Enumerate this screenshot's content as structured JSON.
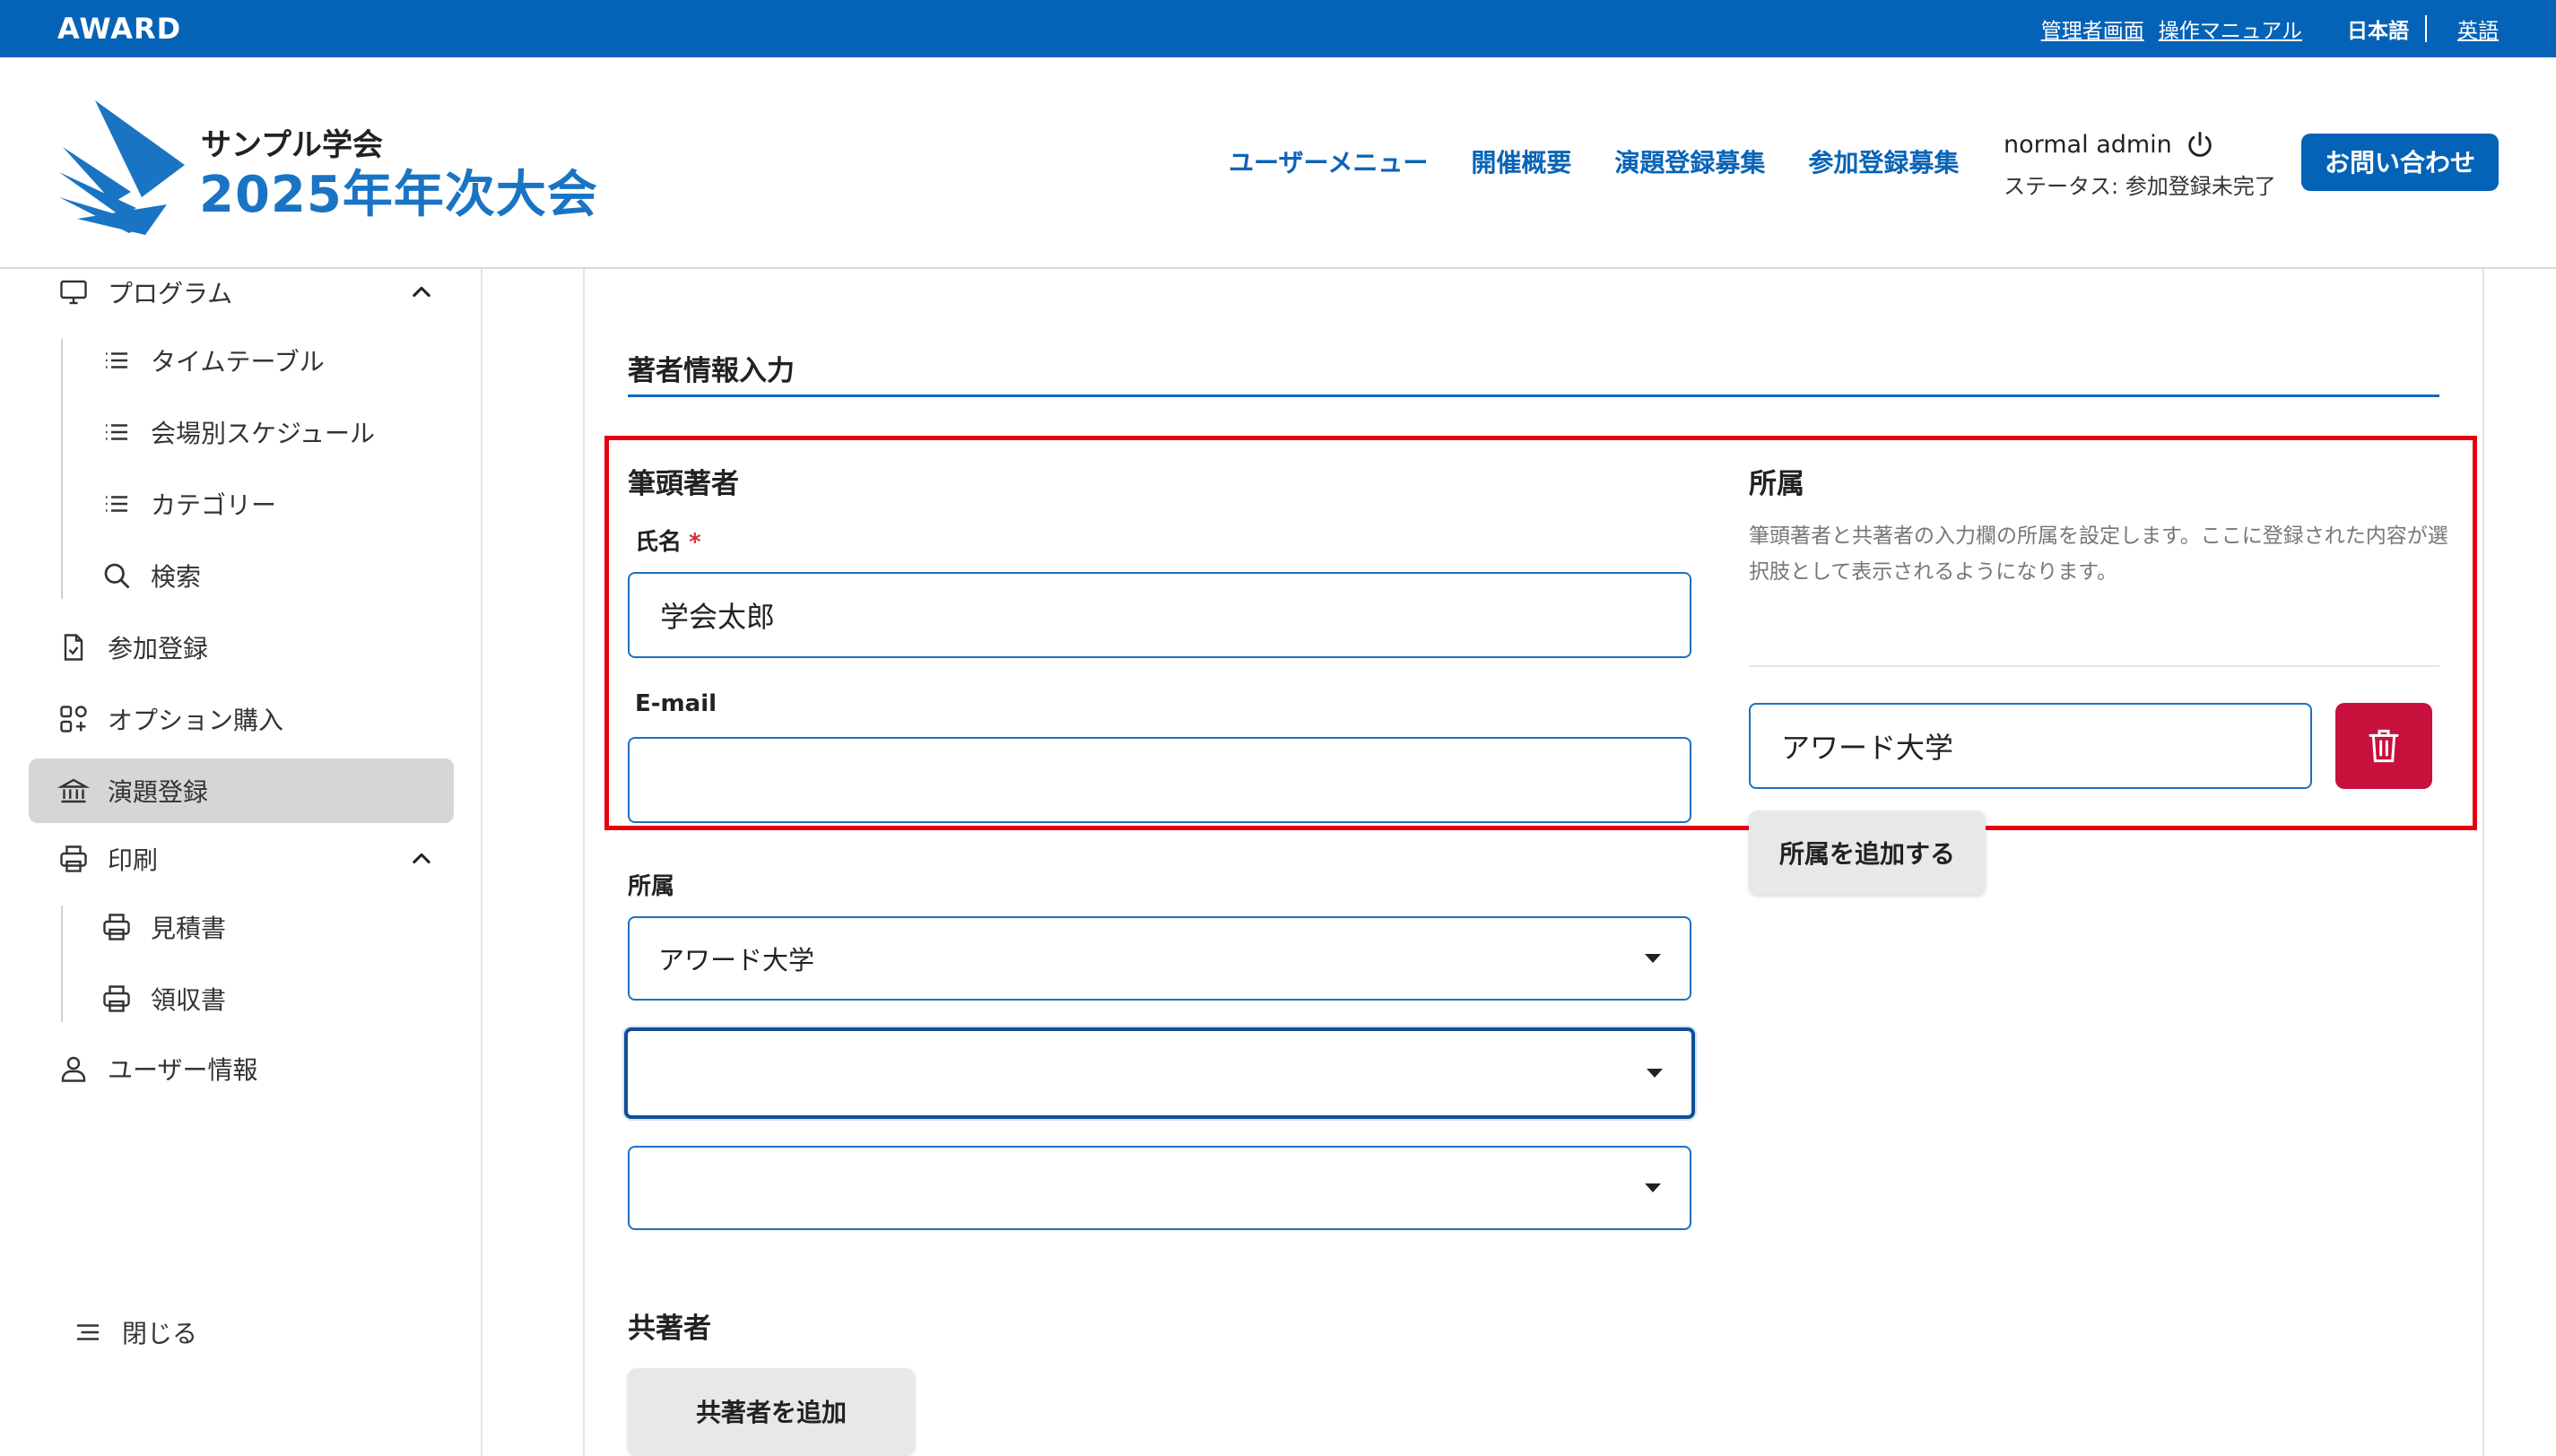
{
  "topbar": {
    "logo": "AWARD",
    "admin_link": "管理者画面",
    "manual_link": "操作マニュアル",
    "lang_current": "日本語",
    "lang_other": "英語"
  },
  "header": {
    "brand_sub": "サンプル学会",
    "brand_main": "2025年年次大会",
    "nav": [
      "ユーザーメニュー",
      "開催概要",
      "演題登録募集",
      "参加登録募集"
    ],
    "user_name": "normal admin",
    "user_status": "ステータス: 参加登録未完了",
    "contact_label": "お問い合わせ"
  },
  "sidebar": {
    "program": "プログラム",
    "timetable": "タイムテーブル",
    "venue_schedule": "会場別スケジュール",
    "category": "カテゴリー",
    "search": "検索",
    "participation": "参加登録",
    "option": "オプション購入",
    "abstract": "演題登録",
    "print": "印刷",
    "estimate": "見積書",
    "receipt": "領収書",
    "user_info": "ユーザー情報",
    "close": "閉じる"
  },
  "form": {
    "section_title": "著者情報入力",
    "first_author_heading": "筆頭著者",
    "name_label": "氏名",
    "required_mark": "*",
    "name_value": "学会太郎",
    "email_label": "E-mail",
    "email_value": "",
    "affiliation_label": "所属",
    "affiliation_select_1": "アワード大学",
    "affiliation_select_2": "",
    "affiliation_select_3": "",
    "coauthor_heading": "共著者",
    "add_coauthor_label": "共著者を追加"
  },
  "affiliation_panel": {
    "heading": "所属",
    "description": "筆頭著者と共著者の入力欄の所属を設定します。ここに登録された内容が選択肢として表示されるようになります。",
    "entry_value": "アワード大学",
    "add_label": "所属を追加する"
  },
  "colors": {
    "brand_blue": "#0563b7",
    "delete_red": "#c8103c",
    "highlight_red": "#e6000f"
  }
}
